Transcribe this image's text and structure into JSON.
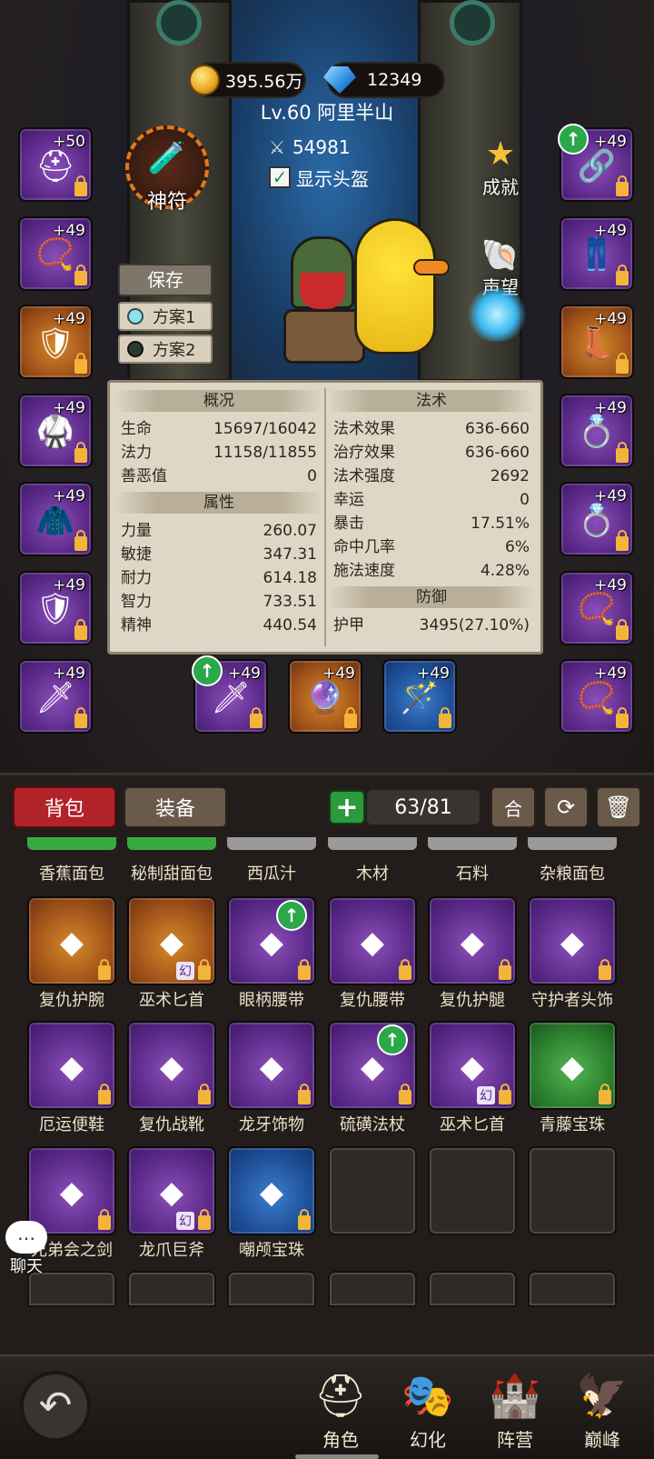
{
  "currency": {
    "gold": "395.56万",
    "gems": "12349"
  },
  "player": {
    "level_name": "Lv.60 阿里半山",
    "power": "54981",
    "show_helmet": "显示头盔"
  },
  "buttons": {
    "talisman": "神符",
    "achievement": "成就",
    "reputation": "声望",
    "save": "保存",
    "plan1": "方案1",
    "plan2": "方案2"
  },
  "left_slots": [
    {
      "level": "+50",
      "color": "purple",
      "icon": "helmet-icon"
    },
    {
      "level": "+49",
      "color": "purple",
      "icon": "necklace-icon"
    },
    {
      "level": "+49",
      "color": "orange",
      "icon": "shoulder-icon"
    },
    {
      "level": "+49",
      "color": "purple",
      "icon": "chest-armor-icon"
    },
    {
      "level": "+49",
      "color": "purple",
      "icon": "cloak-icon"
    },
    {
      "level": "+49",
      "color": "purple",
      "icon": "bracer-icon"
    },
    {
      "level": "+49",
      "color": "purple",
      "icon": "dagger-icon"
    }
  ],
  "right_slots": [
    {
      "level": "+49",
      "color": "purple",
      "icon": "belt-icon"
    },
    {
      "level": "+49",
      "color": "purple",
      "icon": "leggings-icon"
    },
    {
      "level": "+49",
      "color": "orange",
      "icon": "boots-icon"
    },
    {
      "level": "+49",
      "color": "purple",
      "icon": "ring-icon"
    },
    {
      "level": "+49",
      "color": "purple",
      "icon": "ring-icon"
    },
    {
      "level": "+49",
      "color": "purple",
      "icon": "amulet-icon"
    },
    {
      "level": "+49",
      "color": "purple",
      "icon": "amulet-icon"
    }
  ],
  "weapon_slots": [
    {
      "level": "+49",
      "color": "purple",
      "icon": "sword-icon"
    },
    {
      "level": "+49",
      "color": "orange",
      "icon": "orb-icon"
    },
    {
      "level": "+49",
      "color": "blue",
      "icon": "staff-icon"
    }
  ],
  "stats": {
    "overview_title": "概况",
    "attr_title": "属性",
    "magic_title": "法术",
    "defense_title": "防御",
    "overview": [
      [
        "生命",
        "15697/16042"
      ],
      [
        "法力",
        "11158/11855"
      ],
      [
        "善恶值",
        "0"
      ]
    ],
    "attributes": [
      [
        "力量",
        "260.07"
      ],
      [
        "敏捷",
        "347.31"
      ],
      [
        "耐力",
        "614.18"
      ],
      [
        "智力",
        "733.51"
      ],
      [
        "精神",
        "440.54"
      ]
    ],
    "magic": [
      [
        "法术效果",
        "636-660"
      ],
      [
        "治疗效果",
        "636-660"
      ],
      [
        "法术强度",
        "2692"
      ],
      [
        "幸运",
        "0"
      ],
      [
        "暴击",
        "17.51%"
      ],
      [
        "命中几率",
        "6%"
      ],
      [
        "施法速度",
        "4.28%"
      ]
    ],
    "defense": [
      [
        "护甲",
        "3495(27.10%)"
      ]
    ]
  },
  "bag": {
    "tab_bag": "背包",
    "tab_equip": "装备",
    "capacity": "63/81",
    "merge": "合"
  },
  "item_row0": [
    "香蕉面包",
    "秘制甜面包",
    "西瓜汁",
    "木材",
    "石料",
    "杂粮面包"
  ],
  "item_row1": [
    {
      "name": "复仇护腕",
      "color": "orange"
    },
    {
      "name": "巫术匕首",
      "color": "orange",
      "tag": "幻"
    },
    {
      "name": "眼柄腰带",
      "color": "purple",
      "up": true
    },
    {
      "name": "复仇腰带",
      "color": "purple"
    },
    {
      "name": "复仇护腿",
      "color": "purple"
    },
    {
      "name": "守护者头饰",
      "color": "purple"
    }
  ],
  "item_row2": [
    {
      "name": "厄运便鞋",
      "color": "purple"
    },
    {
      "name": "复仇战靴",
      "color": "purple"
    },
    {
      "name": "龙牙饰物",
      "color": "purple"
    },
    {
      "name": "硫磺法杖",
      "color": "purple",
      "up": true
    },
    {
      "name": "巫术匕首",
      "color": "purple",
      "tag": "幻"
    },
    {
      "name": "青藤宝珠",
      "color": "green"
    }
  ],
  "item_row3": [
    {
      "name": "兄弟会之剑",
      "color": "purple"
    },
    {
      "name": "龙爪巨斧",
      "color": "purple",
      "tag": "幻"
    },
    {
      "name": "嘲颅宝珠",
      "color": "blue"
    }
  ],
  "chat": "聊天",
  "nav": [
    {
      "label": "角色",
      "icon": "helmet-icon"
    },
    {
      "label": "幻化",
      "icon": "mask-icon"
    },
    {
      "label": "阵营",
      "icon": "banner-icon"
    },
    {
      "label": "巅峰",
      "icon": "crest-icon"
    }
  ]
}
